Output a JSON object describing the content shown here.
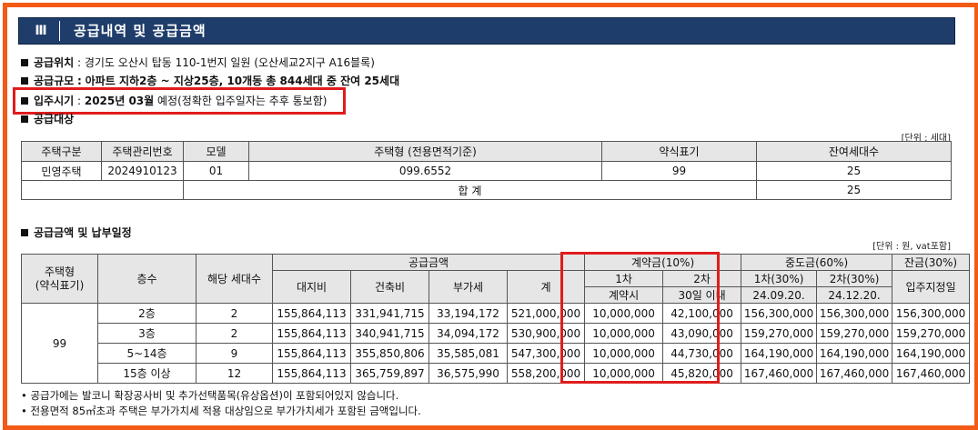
{
  "header": {
    "number": "Ⅲ",
    "title": "공급내역 및 공급금액"
  },
  "info": {
    "location_label": "공급위치",
    "location_value": "경기도 오산시 탑동 110-1번지 일원 (오산세교2지구 A16블록)",
    "scale_label": "공급규모",
    "scale_value": "아파트 지하2층 ~ 지상25층, 10개동 총 844세대 중 잔여 25세대",
    "movein_label": "입주시기",
    "movein_value_bold": "2025년 03월",
    "movein_value_rest": " 예정(정확한 입주일자는 추후 통보함)",
    "target_label": "공급대상"
  },
  "table1": {
    "unit": "[단위 : 세대]",
    "headers": [
      "주택구분",
      "주택관리번호",
      "모델",
      "주택형 (전용면적기준)",
      "약식표기",
      "잔여세대수"
    ],
    "row": [
      "민영주택",
      "2024910123",
      "01",
      "099.6552",
      "99",
      "25"
    ],
    "total_label": "합 계",
    "total_value": "25"
  },
  "section2_title": "공급금액 및 납부일정",
  "table2": {
    "unit": "[단위 : 원, vat포함]",
    "h_type": "주택형\n(약식표기)",
    "h_floor": "층수",
    "h_units": "해당 세대수",
    "h_supply": "공급금액",
    "h_land": "대지비",
    "h_build": "건축비",
    "h_vat": "부가세",
    "h_total": "계",
    "h_deposit": "계약금(10%)",
    "h_dep1": "1차",
    "h_dep1_sub": "계약시",
    "h_dep2": "2차",
    "h_dep2_sub": "30일 이내",
    "h_mid": "중도금(60%)",
    "h_mid1": "1차(30%)",
    "h_mid1_date": "24.09.20.",
    "h_mid2": "2차(30%)",
    "h_mid2_date": "24.12.20.",
    "h_balance": "잔금(30%)",
    "h_balance_sub": "입주지정일",
    "type_value": "99",
    "rows": [
      [
        "2층",
        "2",
        "155,864,113",
        "331,941,715",
        "33,194,172",
        "521,000,000",
        "10,000,000",
        "42,100,000",
        "156,300,000",
        "156,300,000",
        "156,300,000"
      ],
      [
        "3층",
        "2",
        "155,864,113",
        "340,941,715",
        "34,094,172",
        "530,900,000",
        "10,000,000",
        "43,090,000",
        "159,270,000",
        "159,270,000",
        "159,270,000"
      ],
      [
        "5~14층",
        "9",
        "155,864,113",
        "355,850,806",
        "35,585,081",
        "547,300,000",
        "10,000,000",
        "44,730,000",
        "164,190,000",
        "164,190,000",
        "164,190,000"
      ],
      [
        "15층 이상",
        "12",
        "155,864,113",
        "365,759,897",
        "36,575,990",
        "558,200,000",
        "10,000,000",
        "45,820,000",
        "167,460,000",
        "167,460,000",
        "167,460,000"
      ]
    ]
  },
  "notes": [
    "• 공급가에는 발코니 확장공사비 및 추가선택품목(유상옵션)이 포함되어있지 않습니다.",
    "• 전용면적 85㎡초과 주택은 부가가치세 적용 대상임으로 부가가치세가 포함된 금액입니다."
  ],
  "colors": {
    "frame": "#f25a15",
    "header_bg": "#1f3d6b",
    "highlight": "#e01c1c",
    "table_header_bg": "#e6e6e6"
  }
}
